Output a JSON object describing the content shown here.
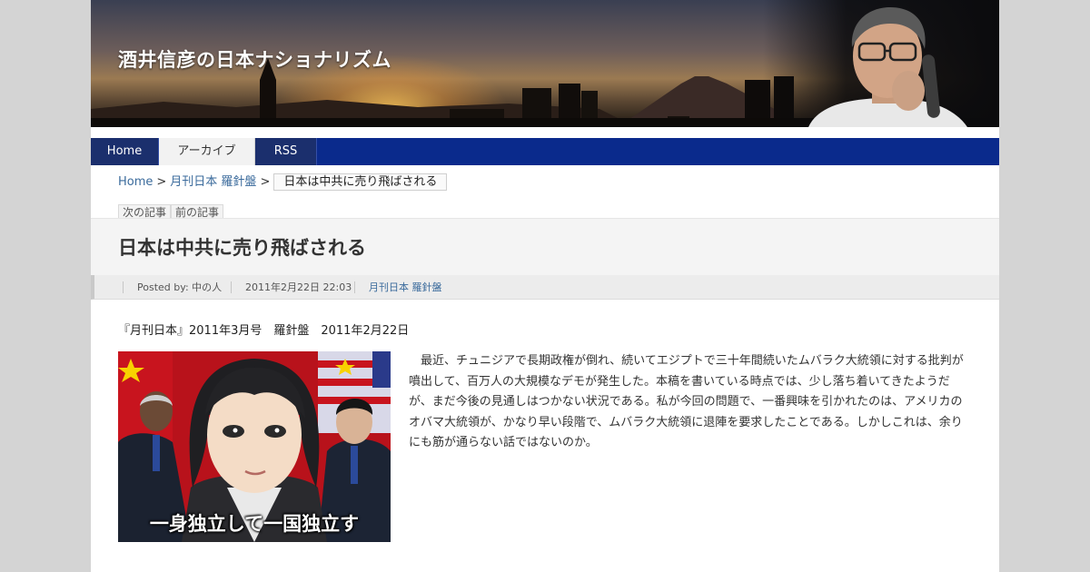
{
  "header": {
    "site_title": "酒井信彦の日本ナショナリズム"
  },
  "nav": {
    "items": [
      {
        "label": "Home"
      },
      {
        "label": "アーカイブ"
      },
      {
        "label": "RSS"
      }
    ]
  },
  "breadcrumb": {
    "home": "Home",
    "separator": ">",
    "category": "月刊日本 羅針盤",
    "current": "日本は中共に売り飛ばされる"
  },
  "pager": {
    "next": "次の記事",
    "prev": "前の記事"
  },
  "post": {
    "title": "日本は中共に売り飛ばされる",
    "meta": {
      "posted_by": "Posted by: 中の人",
      "date": "2011年2月22日 22:03",
      "category": "月刊日本 羅針盤"
    },
    "source_line": "『月刊日本』2011年3月号　羅針盤　2011年2月22日",
    "image": {
      "caption": "一身独立して一国独立す"
    },
    "body": "　最近、チュニジアで長期政権が倒れ、続いてエジプトで三十年間続いたムバラク大統領に対する批判が噴出して、百万人の大規模なデモが発生した。本稿を書いている時点では、少し落ち着いてきたようだが、まだ今後の見通しはつかない状況である。私が今回の問題で、一番興味を引かれたのは、アメリカのオバマ大統領が、かなり早い段階で、ムバラク大統領に退陣を要求したことである。しかしこれは、余りにも筋が通らない話ではないのか。"
  },
  "colors": {
    "nav_bg": "#0a2a8c",
    "nav_active": "#1b2f6d",
    "link": "#3b6b9c",
    "page_bg": "#d4d4d4"
  }
}
